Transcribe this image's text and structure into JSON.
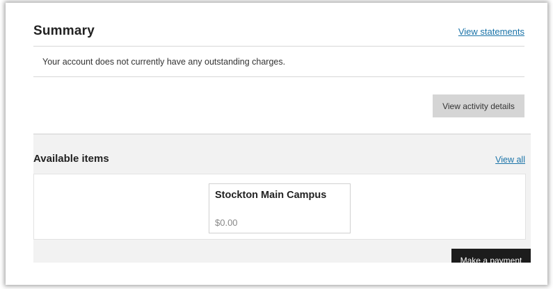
{
  "summary": {
    "title": "Summary",
    "view_statements_label": "View statements",
    "charges_message": "Your account does not currently have any outstanding charges.",
    "view_activity_label": "View activity details"
  },
  "available_items": {
    "title": "Available items",
    "view_all_label": "View all",
    "items": [
      {
        "name": "Stockton Main Campus",
        "price": "$0.00"
      }
    ],
    "make_payment_label": "Make a payment"
  }
}
